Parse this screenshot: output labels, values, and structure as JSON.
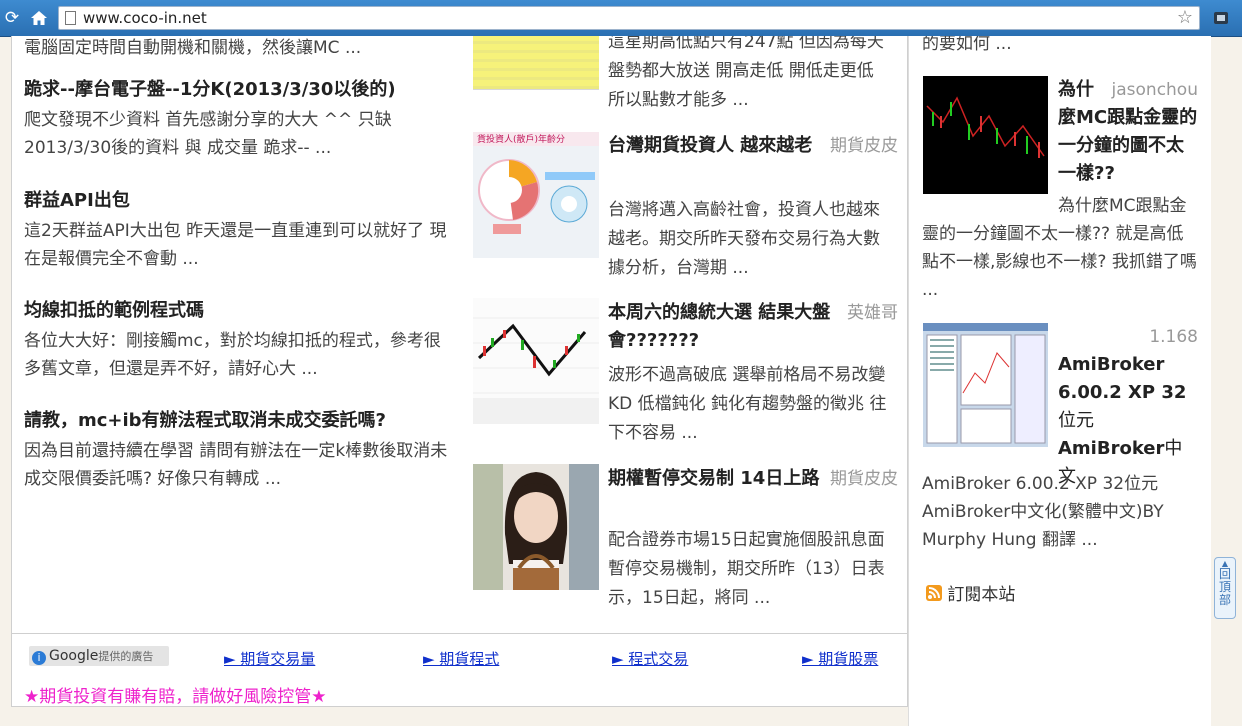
{
  "browser": {
    "url": "www.coco-in.net"
  },
  "left_posts": {
    "clipped_top": "電腦固定時間自動開機和關機，然後讓MC ...",
    "items": [
      {
        "title": "跪求--摩台電子盤--1分K(2013/3/30以後的)",
        "excerpt": "爬文發現不少資料 首先感謝分享的大大 ^^ 只缺2013/3/30後的資料 與 成交量 跪求-- ..."
      },
      {
        "title": "群益API出包",
        "excerpt": "這2天群益API大出包 昨天還是一直重連到可以就好了 現在是報價完全不會動 ..."
      },
      {
        "title": "均線扣抵的範例程式碼",
        "excerpt": "各位大大好：剛接觸mc，對於均線扣抵的程式，參考很多舊文章，但還是弄不好，請好心大 ..."
      },
      {
        "title": "請教，mc+ib有辦法程式取消未成交委託嗎?",
        "excerpt": "因為目前還持續在學習 請問有辦法在一定k棒數後取消未成交限價委託嗎? 好像只有轉成 ..."
      }
    ]
  },
  "mid_posts": {
    "clipped_top": "這星期高低點只有247點 但因為每天盤勢都大放送 開高走低 開低走更低 所以點數才能多 ...",
    "items": [
      {
        "title": "台灣期貨投資人 越來越老",
        "author": "期貨皮皮",
        "excerpt": "台灣將邁入高齡社會，投資人也越來越老。期交所昨天發布交易行為大數據分析，台灣期 ..."
      },
      {
        "title": "本周六的總統大選 結果大盤會???????",
        "author": "英雄哥",
        "excerpt": "波形不過高破底 選舉前格局不易改變 KD 低檔鈍化 鈍化有趨勢盤的徵兆 往下不容易 ..."
      },
      {
        "title": "期權暫停交易制 14日上路",
        "author": "期貨皮皮",
        "excerpt": "配合證券市場15日起實施個股訊息面暫停交易機制，期交所昨（13）日表示，15日起，將同 ..."
      }
    ]
  },
  "right_posts": {
    "clipped_top": "的要如何 ...",
    "items": [
      {
        "author": "jasonchou",
        "title": "為什麼MC跟點金靈的一分鐘的圖不太一樣??",
        "excerpt": "為什麼MC跟點金靈的一分鐘圖不太一樣?? 就是高低點不一樣,影線也不一樣? 我抓錯了嗎 ..."
      },
      {
        "author": "1.168",
        "title_bold1": "AmiBroker 6.00.2 XP 32",
        "title_normal": "位元",
        "title_bold2": "AmiBroker",
        "title_tail": "中文",
        "excerpt": "AmiBroker 6.00.2 XP 32位元AmiBroker中文化(繁體中文)BY Murphy Hung 翻譯 ..."
      }
    ],
    "rss_label": "訂閱本站"
  },
  "ads": {
    "badge": "Google",
    "badge_sub": "提供的廣告",
    "links": [
      "► 期貨交易量",
      "► 期貨程式",
      "► 程式交易",
      "► 期貨股票"
    ],
    "warning": "★期貨投資有賺有賠，請做好風險控管★"
  },
  "back_to_top": "回頂部",
  "colors": {
    "browser_bar": "#3e8bd0",
    "link_blue": "#1030cc",
    "warning_pink": "#ee22cc"
  }
}
